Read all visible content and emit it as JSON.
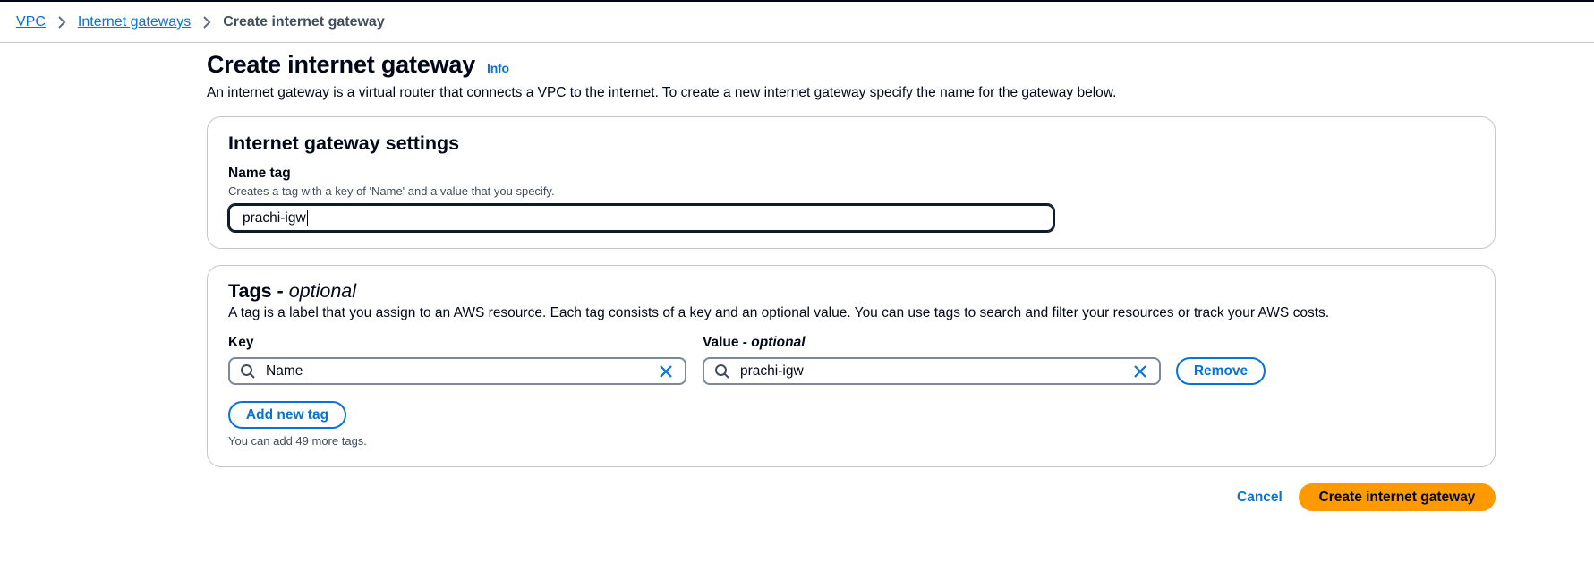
{
  "breadcrumb": {
    "items": [
      {
        "label": "VPC"
      },
      {
        "label": "Internet gateways"
      },
      {
        "label": "Create internet gateway"
      }
    ]
  },
  "page": {
    "title": "Create internet gateway",
    "info_label": "Info",
    "description": "An internet gateway is a virtual router that connects a VPC to the internet. To create a new internet gateway specify the name for the gateway below."
  },
  "settings": {
    "heading": "Internet gateway settings",
    "name_tag_label": "Name tag",
    "name_tag_description": "Creates a tag with a key of 'Name' and a value that you specify.",
    "name_tag_value": "prachi-igw"
  },
  "tags": {
    "heading": "Tags - ",
    "heading_optional": "optional",
    "description": "A tag is a label that you assign to an AWS resource. Each tag consists of a key and an optional value. You can use tags to search and filter your resources or track your AWS costs.",
    "key_label": "Key",
    "value_label": "Value - ",
    "value_label_optional": "optional",
    "rows": [
      {
        "key": "Name",
        "value": "prachi-igw"
      }
    ],
    "remove_label": "Remove",
    "add_label": "Add new tag",
    "remaining_text": "You can add 49 more tags."
  },
  "actions": {
    "cancel_label": "Cancel",
    "submit_label": "Create internet gateway"
  },
  "colors": {
    "link": "#0972d3",
    "primary": "#ff9900",
    "text": "#000716",
    "border": "#c6c6cd"
  },
  "icons": [
    "chevron-right-icon",
    "search-icon",
    "close-icon"
  ]
}
